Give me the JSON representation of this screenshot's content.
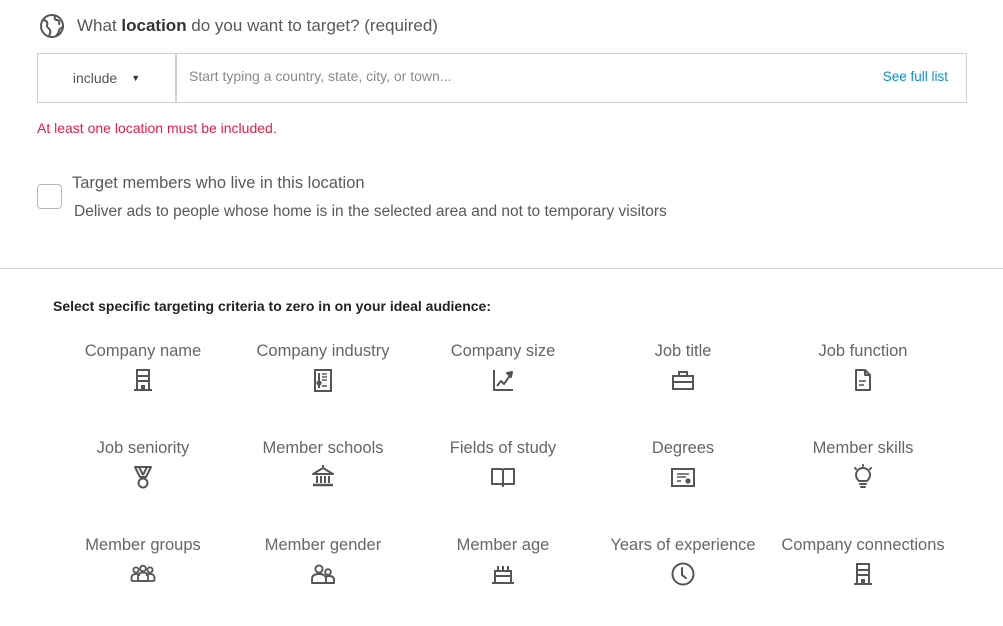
{
  "location": {
    "question_prefix": "What ",
    "question_bold": "location",
    "question_suffix": " do you want to target? (required)",
    "globe_icon": "globe-icon",
    "mode_select": {
      "value": "include",
      "caret": "▼"
    },
    "input": {
      "value": "",
      "placeholder": "Start typing a country, state, city, or town..."
    },
    "see_full_list": "See full list",
    "error": "At least one location must be included.",
    "error_color": "#e0204a",
    "link_color": "#0a8fc4"
  },
  "residence_option": {
    "checked": false,
    "title": "Target members who live in this location",
    "description": "Deliver ads to people whose home is in the selected area and not to temporary visitors"
  },
  "criteria": {
    "heading": "Select specific targeting criteria to zero in on your ideal audience:",
    "items": [
      {
        "label": "Company name",
        "icon": "building-icon"
      },
      {
        "label": "Company industry",
        "icon": "industry-document-icon"
      },
      {
        "label": "Company size",
        "icon": "growth-chart-icon"
      },
      {
        "label": "Job title",
        "icon": "briefcase-icon"
      },
      {
        "label": "Job function",
        "icon": "document-icon"
      },
      {
        "label": "Job seniority",
        "icon": "medal-icon"
      },
      {
        "label": "Member schools",
        "icon": "institution-icon"
      },
      {
        "label": "Fields of study",
        "icon": "open-book-icon"
      },
      {
        "label": "Degrees",
        "icon": "certificate-icon"
      },
      {
        "label": "Member skills",
        "icon": "lightbulb-icon"
      },
      {
        "label": "Member groups",
        "icon": "group-icon"
      },
      {
        "label": "Member gender",
        "icon": "two-people-icon"
      },
      {
        "label": "Member age",
        "icon": "birthday-cake-icon"
      },
      {
        "label": "Years of experience",
        "icon": "clock-icon"
      },
      {
        "label": "Company connections",
        "icon": "building-icon"
      }
    ]
  }
}
